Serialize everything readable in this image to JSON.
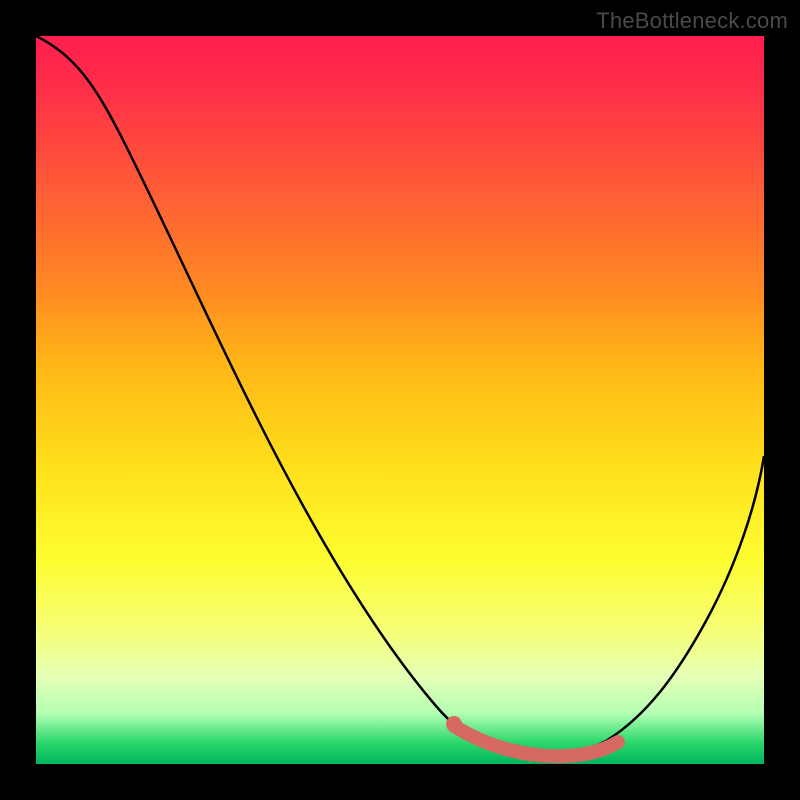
{
  "watermark": "TheBottleneck.com",
  "chart_data": {
    "type": "line",
    "title": "",
    "xlabel": "",
    "ylabel": "",
    "xlim": [
      0,
      100
    ],
    "ylim": [
      0,
      100
    ],
    "series": [
      {
        "name": "bottleneck_curve",
        "color": "#000000",
        "x": [
          0,
          6,
          12,
          18,
          24,
          30,
          36,
          42,
          48,
          54,
          58,
          62,
          66,
          70,
          74,
          78,
          82,
          86,
          90,
          94,
          100
        ],
        "y": [
          100,
          97,
          90,
          81,
          70,
          59,
          48,
          37,
          26,
          15,
          8,
          4,
          1,
          0,
          0,
          1,
          4,
          10,
          18,
          28,
          45
        ]
      }
    ],
    "annotations": [
      {
        "name": "optimal_range_highlight",
        "type": "segment",
        "color": "#d66a63",
        "x1": 58,
        "y1": 5,
        "x2": 78,
        "y2": 2
      },
      {
        "name": "optimal_point",
        "type": "dot",
        "color": "#d66a63",
        "x": 58,
        "y": 6
      }
    ],
    "legend": false,
    "grid": false
  }
}
